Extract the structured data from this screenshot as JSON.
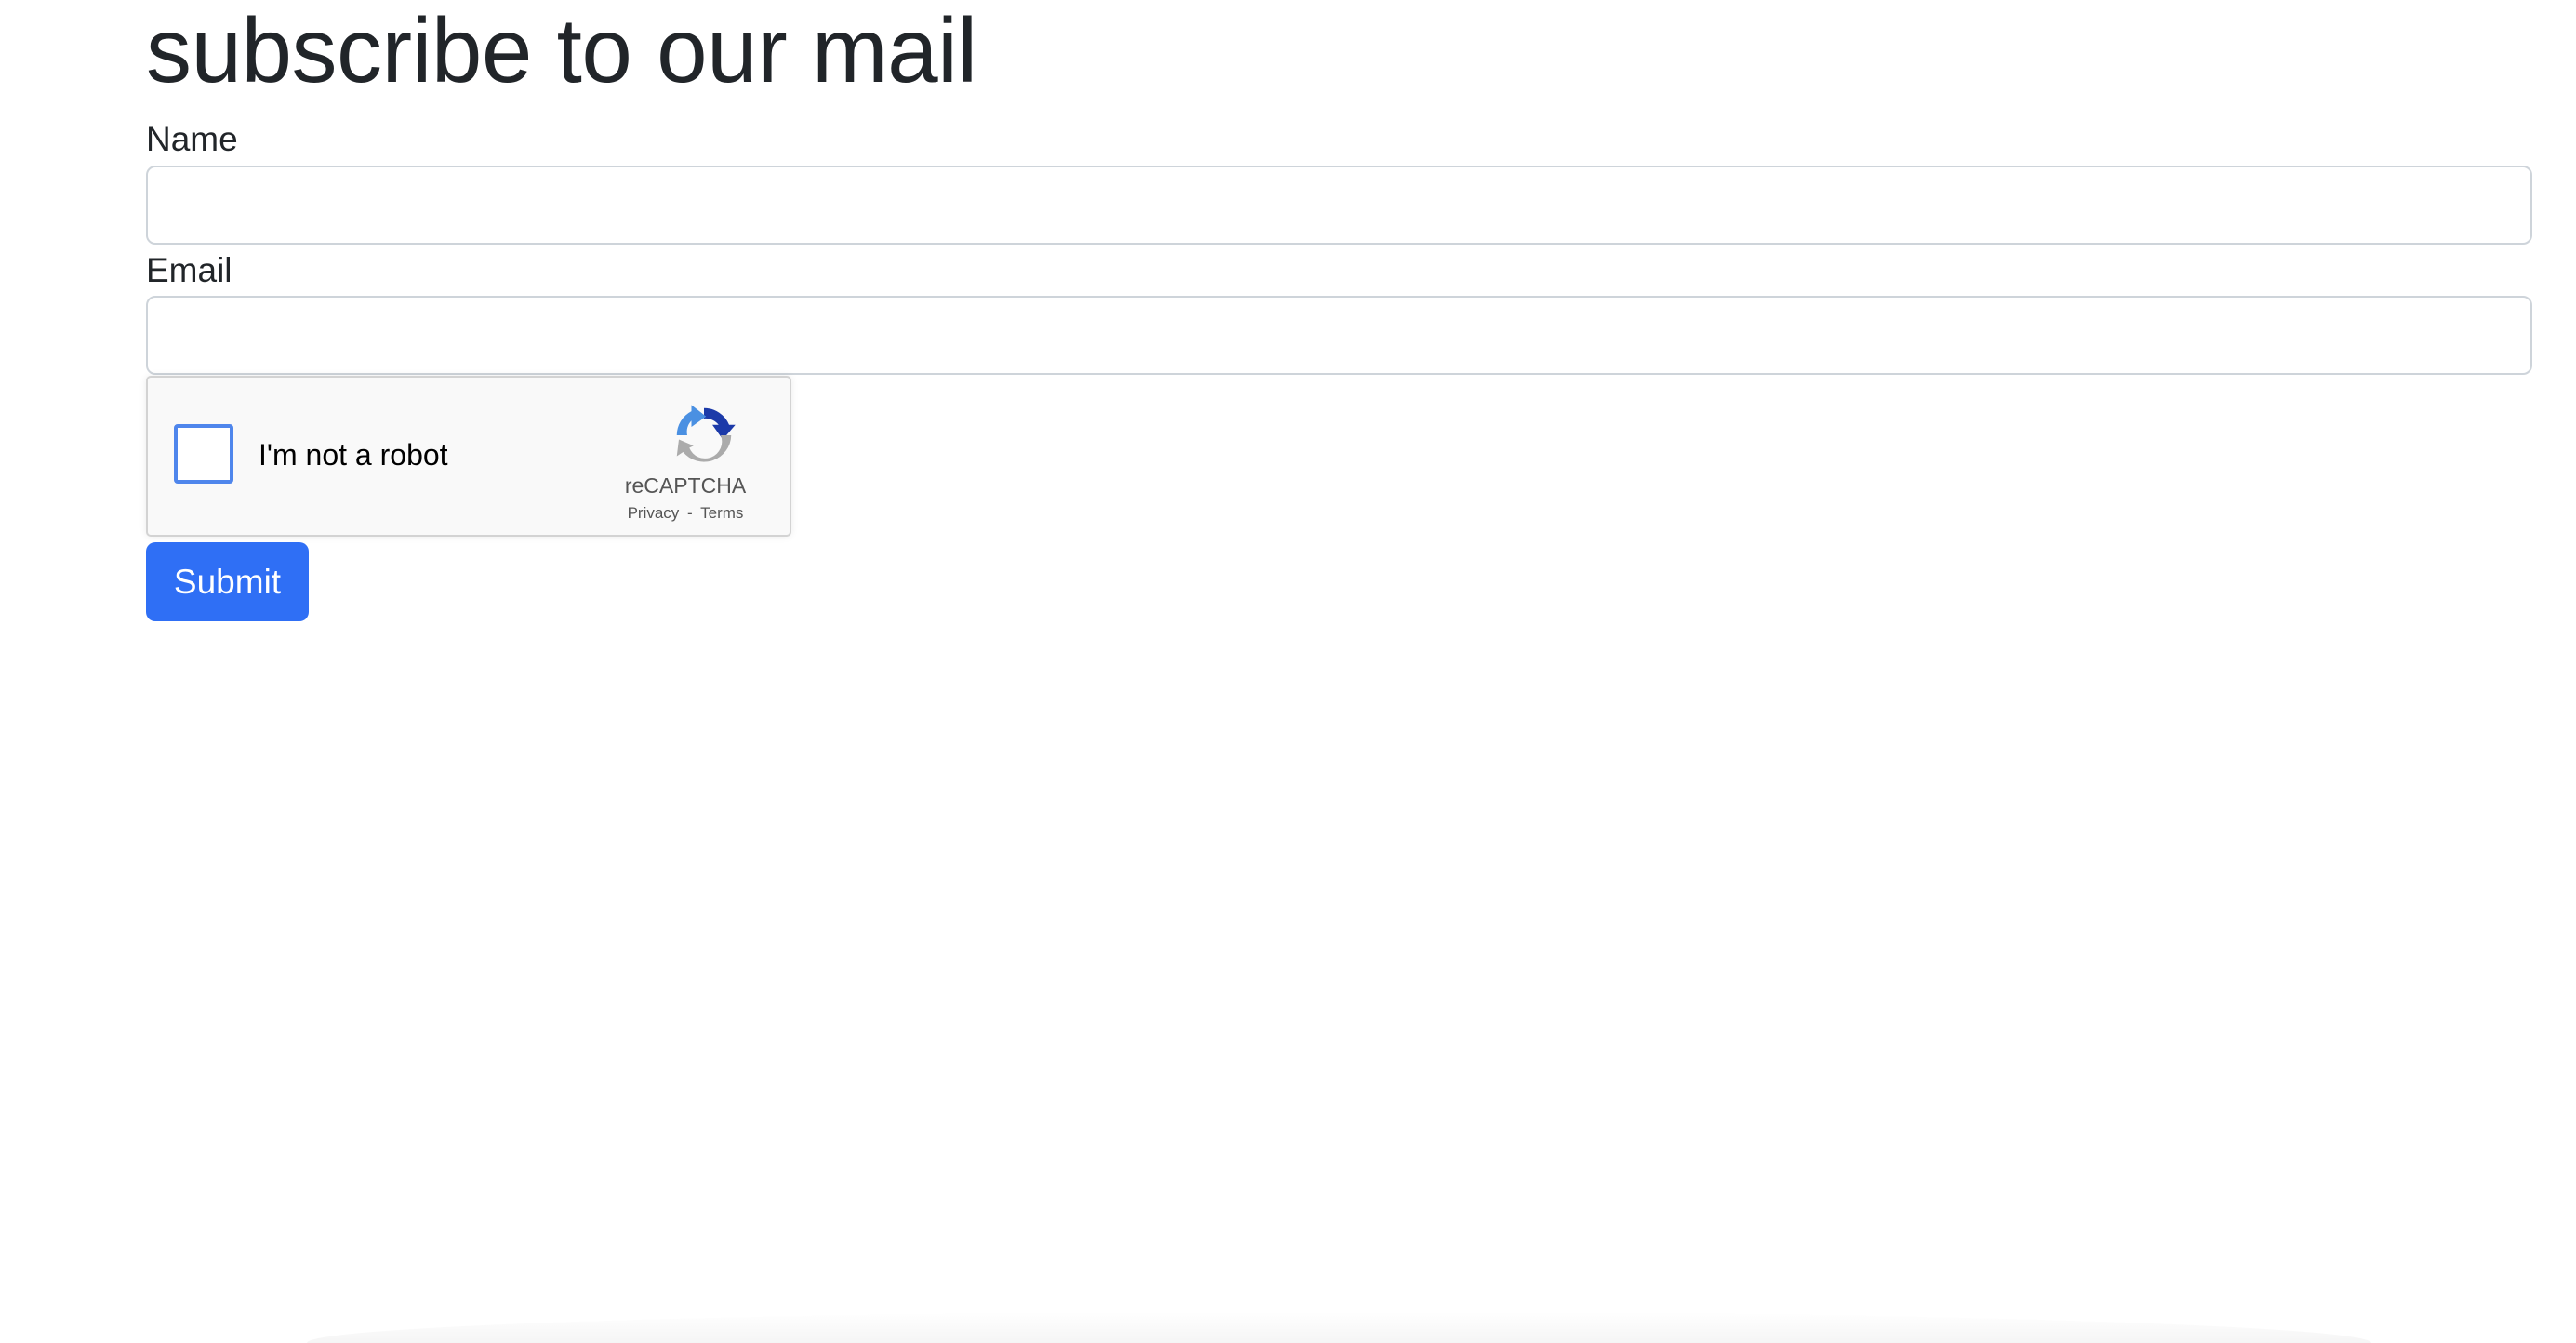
{
  "page": {
    "title": "subscribe to our mail"
  },
  "form": {
    "name_label": "Name",
    "name_value": "",
    "email_label": "Email",
    "email_value": "",
    "submit_label": "Submit"
  },
  "recaptcha": {
    "checkbox_label": "I'm not a robot",
    "checked": false,
    "brand": "reCAPTCHA",
    "privacy_link": "Privacy",
    "separator": "-",
    "terms_link": "Terms",
    "logo_icon": "recaptcha-logo-icon"
  },
  "colors": {
    "button_bg": "#2f6ff5",
    "checkbox_border": "#4f86ec",
    "text": "#212529",
    "input_border": "#ced4da"
  }
}
